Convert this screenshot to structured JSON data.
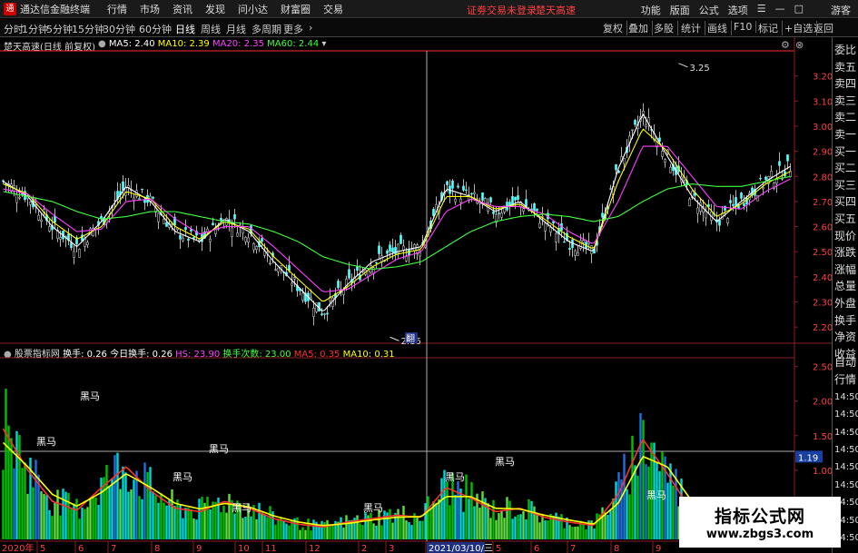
{
  "app": {
    "name": "通达信金融终端"
  },
  "menu": [
    "行情",
    "市场",
    "资讯",
    "发现",
    "问小达",
    "财富圈",
    "交易"
  ],
  "notices": [
    "证劵交易未登录",
    "楚天高速"
  ],
  "top_right": {
    "items": [
      "功能",
      "版面",
      "公式",
      "选项"
    ],
    "guest": "游客"
  },
  "periods": [
    "分时",
    "1分钟",
    "5分钟",
    "15分钟",
    "30分钟",
    "60分钟",
    "日线",
    "周线",
    "月线",
    "多周期",
    "更多"
  ],
  "active_period": "日线",
  "toolbar_right": [
    "复权",
    "叠加",
    "多股",
    "统计",
    "画线",
    "F10",
    "标记",
    "+自选",
    "返回"
  ],
  "main_chart": {
    "title": "楚天高速(日线 前复权)",
    "ma": [
      {
        "label": "MA5: 2.40",
        "color": "#ffffff"
      },
      {
        "label": "MA10: 2.39",
        "color": "#ffff00"
      },
      {
        "label": "MA20: 2.35",
        "color": "#ff40ff"
      },
      {
        "label": "MA60: 2.44",
        "color": "#40ff40"
      }
    ],
    "price_ticks": [
      "3.20",
      "3.10",
      "3.00",
      "2.90",
      "2.80",
      "2.70",
      "2.60",
      "2.50",
      "2.40",
      "2.30",
      "2.20"
    ],
    "high_label": "3.25",
    "low_label": "2.16",
    "cursor_label": "翻"
  },
  "sub_chart": {
    "title": "股票指标网",
    "items": [
      {
        "label": "换手: 0.26",
        "color": "#ffffff"
      },
      {
        "label": "今日换手: 0.26",
        "color": "#ffffff"
      },
      {
        "label": "HS: 23.90",
        "color": "#ff40ff"
      },
      {
        "label": "换手次数: 23.00",
        "color": "#40ff40"
      },
      {
        "label": "MA5: 0.35",
        "color": "#ff3030"
      },
      {
        "label": "MA10: 0.31",
        "color": "#ffff00"
      }
    ],
    "ticks": [
      "2.50",
      "2.00",
      "1.50",
      "1.00"
    ],
    "level": "1.19",
    "marker_text": "黑马"
  },
  "x_axis": {
    "labels": [
      "2020年",
      "5",
      "6",
      "7",
      "8",
      "9",
      "10",
      "11",
      "12",
      "2",
      "3",
      "2021/03/10/三",
      "5",
      "6",
      "7",
      "8",
      "9"
    ]
  },
  "sidebar": [
    "委比",
    "卖五",
    "卖四",
    "卖三",
    "卖二",
    "卖一",
    "买一",
    "买二",
    "买三",
    "买四",
    "买五",
    "现价",
    "涨跌",
    "涨幅",
    "总量",
    "外盘",
    "换手",
    "净资",
    "收益",
    "自动",
    "行情",
    "14:50",
    "14:50",
    "14:50",
    "14:50",
    "14:50",
    "14:50",
    "14:50",
    "14:50",
    "14:50"
  ],
  "watermark": {
    "title": "指标公式网",
    "url": "www.zbgs3.com"
  },
  "chart_data": {
    "type": "line",
    "title": "楚天高速(日线 前复权)",
    "y_range": [
      2.15,
      3.3
    ],
    "x_periods": [
      "2020年",
      "5",
      "6",
      "7",
      "8",
      "9",
      "10",
      "11",
      "12",
      "2",
      "3",
      "2021/03/10/三",
      "5",
      "6",
      "7",
      "8",
      "9"
    ],
    "series": [
      {
        "name": "MA5",
        "values": [
          2.78,
          2.72,
          2.6,
          2.52,
          2.62,
          2.76,
          2.7,
          2.58,
          2.54,
          2.63,
          2.58,
          2.46,
          2.36,
          2.26,
          2.37,
          2.46,
          2.5,
          2.52,
          2.75,
          2.72,
          2.66,
          2.7,
          2.62,
          2.54,
          2.5,
          2.83,
          3.05,
          2.88,
          2.72,
          2.62,
          2.7,
          2.78,
          2.84
        ]
      },
      {
        "name": "MA10",
        "values": [
          2.77,
          2.73,
          2.62,
          2.55,
          2.6,
          2.74,
          2.71,
          2.6,
          2.55,
          2.62,
          2.59,
          2.48,
          2.39,
          2.3,
          2.36,
          2.44,
          2.49,
          2.51,
          2.72,
          2.72,
          2.67,
          2.69,
          2.63,
          2.56,
          2.51,
          2.78,
          2.99,
          2.9,
          2.75,
          2.64,
          2.69,
          2.77,
          2.82
        ]
      },
      {
        "name": "MA20",
        "values": [
          2.75,
          2.73,
          2.65,
          2.58,
          2.59,
          2.7,
          2.71,
          2.63,
          2.57,
          2.6,
          2.6,
          2.52,
          2.43,
          2.34,
          2.35,
          2.41,
          2.47,
          2.5,
          2.66,
          2.71,
          2.68,
          2.68,
          2.65,
          2.58,
          2.53,
          2.7,
          2.92,
          2.92,
          2.8,
          2.68,
          2.67,
          2.74,
          2.79
        ]
      },
      {
        "name": "MA60",
        "values": [
          2.74,
          2.72,
          2.7,
          2.66,
          2.63,
          2.64,
          2.66,
          2.66,
          2.64,
          2.62,
          2.61,
          2.58,
          2.54,
          2.48,
          2.45,
          2.43,
          2.44,
          2.46,
          2.52,
          2.58,
          2.62,
          2.64,
          2.65,
          2.64,
          2.62,
          2.64,
          2.7,
          2.75,
          2.77,
          2.76,
          2.76,
          2.78,
          2.8
        ]
      }
    ],
    "price_high": 3.25,
    "price_low": 2.16,
    "volume_panel": {
      "y_range": [
        0,
        2.6
      ],
      "reference_level": 1.19,
      "turnover_ma5": [
        1.6,
        1.0,
        0.55,
        0.42,
        0.75,
        1.05,
        0.7,
        0.45,
        0.4,
        0.55,
        0.45,
        0.3,
        0.22,
        0.18,
        0.25,
        0.3,
        0.35,
        0.32,
        0.75,
        0.6,
        0.4,
        0.45,
        0.32,
        0.25,
        0.2,
        0.65,
        1.45,
        0.95,
        0.4,
        0.3,
        0.32,
        0.35,
        0.36
      ],
      "turnover_ma10": [
        1.4,
        1.05,
        0.65,
        0.48,
        0.68,
        0.95,
        0.75,
        0.52,
        0.44,
        0.52,
        0.47,
        0.34,
        0.25,
        0.2,
        0.23,
        0.28,
        0.32,
        0.33,
        0.62,
        0.62,
        0.45,
        0.44,
        0.35,
        0.28,
        0.22,
        0.52,
        1.2,
        1.05,
        0.55,
        0.34,
        0.32,
        0.33,
        0.34
      ]
    }
  }
}
